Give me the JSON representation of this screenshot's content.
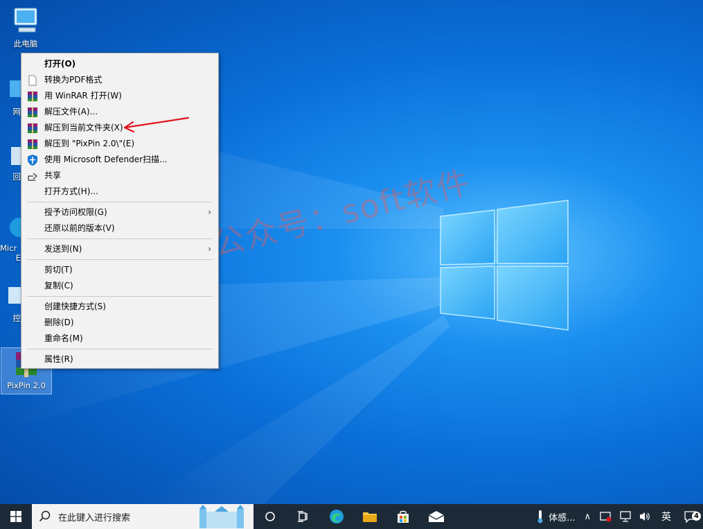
{
  "desktop": {
    "icons": [
      {
        "label": "此电脑"
      },
      {
        "label": "网"
      },
      {
        "label": "回"
      },
      {
        "label": "Micr"
      },
      {
        "label": "E"
      },
      {
        "label": "控"
      },
      {
        "label": "PixPin 2.0"
      }
    ]
  },
  "context_menu": {
    "items": [
      {
        "label": "打开(O)"
      },
      {
        "label": "转换为PDF格式"
      },
      {
        "label": "用 WinRAR 打开(W)"
      },
      {
        "label": "解压文件(A)..."
      },
      {
        "label": "解压到当前文件夹(X)"
      },
      {
        "label": "解压到 \"PixPin 2.0\\\"(E)"
      },
      {
        "label": "使用 Microsoft Defender扫描..."
      },
      {
        "label": "共享"
      },
      {
        "label": "打开方式(H)..."
      },
      {
        "label": "授予访问权限(G)"
      },
      {
        "label": "还原以前的版本(V)"
      },
      {
        "label": "发送到(N)"
      },
      {
        "label": "剪切(T)"
      },
      {
        "label": "复制(C)"
      },
      {
        "label": "创建快捷方式(S)"
      },
      {
        "label": "删除(D)"
      },
      {
        "label": "重命名(M)"
      },
      {
        "label": "属性(R)"
      }
    ],
    "submenu_arrow": "›"
  },
  "watermark": "微信公众号：soft软件",
  "taskbar": {
    "search_placeholder": "在此键入进行搜索",
    "weather": "体感...",
    "ime": "英",
    "notification_count": "4",
    "tray_chevron": "∧"
  },
  "colors": {
    "accent_arrow": "#e0141e",
    "taskbar": "#1c2a38"
  }
}
